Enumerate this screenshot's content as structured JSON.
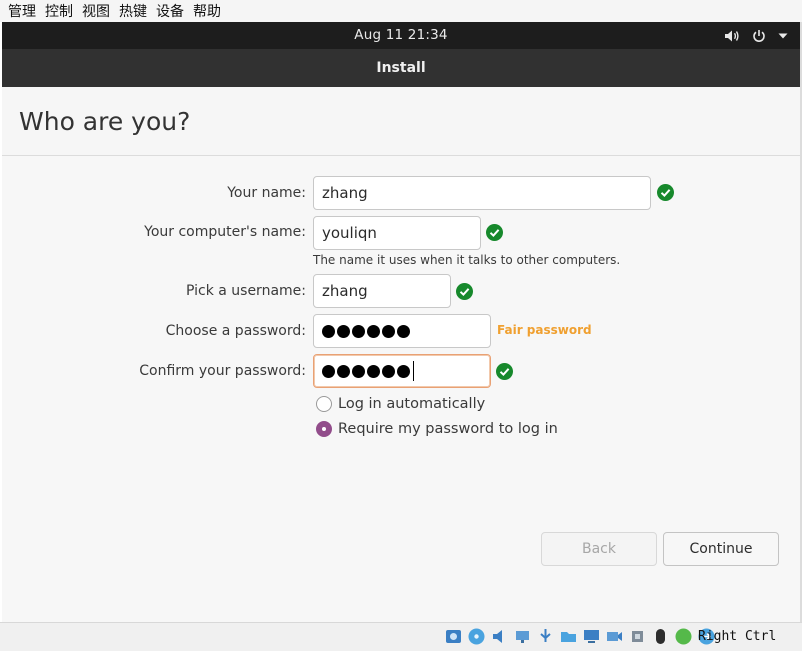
{
  "vbox_menu": [
    "管理",
    "控制",
    "视图",
    "热键",
    "设备",
    "帮助"
  ],
  "topbar": {
    "clock": "Aug 11  21:34"
  },
  "window": {
    "title": "Install"
  },
  "page": {
    "title": "Who are you?"
  },
  "form": {
    "name_label": "Your name:",
    "name_value": "zhang",
    "computer_label": "Your computer's name:",
    "computer_value": "youliqn",
    "computer_hint": "The name it uses when it talks to other computers.",
    "username_label": "Pick a username:",
    "username_value": "zhang",
    "password_label": "Choose a password:",
    "password_dots": 6,
    "password_strength": "Fair password",
    "confirm_label": "Confirm your password:",
    "confirm_dots": 6,
    "login_auto_label": "Log in automatically",
    "login_require_label": "Require my password to log in"
  },
  "buttons": {
    "back": "Back",
    "continue": "Continue"
  },
  "statusbar": {
    "host_key": "Right Ctrl"
  },
  "colors": {
    "check_green": "#17892c",
    "strength_orange": "#f0a030",
    "radio_accent": "#924d8b"
  }
}
